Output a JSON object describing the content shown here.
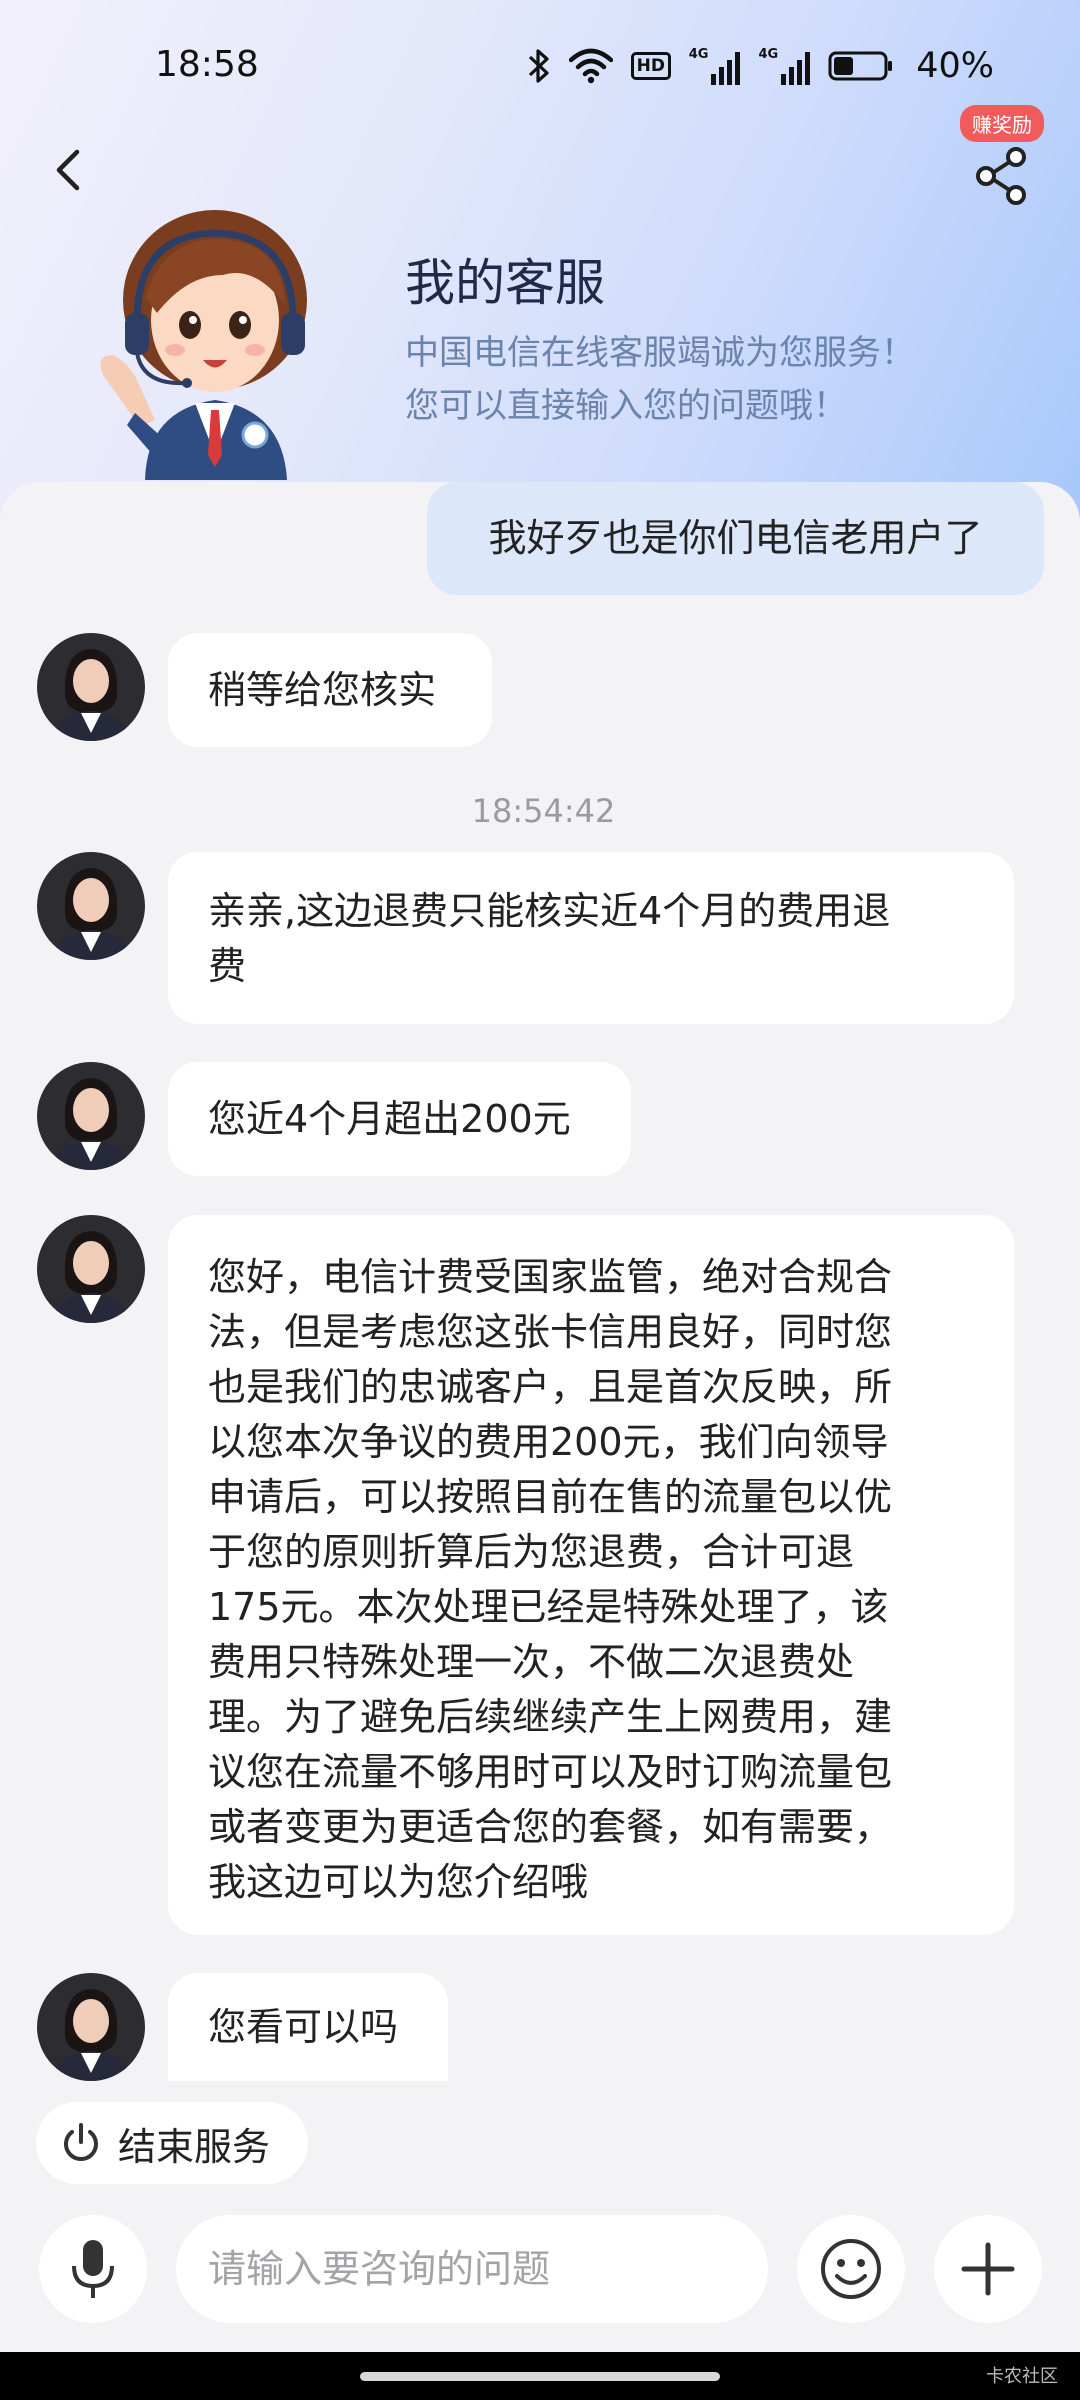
{
  "status_bar": {
    "time": "18:58",
    "hd_label": "HD",
    "net1": "4G",
    "net2": "4G",
    "battery_percent": "40%",
    "battery_level": 0.4
  },
  "header": {
    "reward_badge": "赚奖励",
    "title": "我的客服",
    "subtitle_line1": "中国电信在线客服竭诚为您服务！",
    "subtitle_line2": "您可以直接输入您的问题哦！"
  },
  "chat": {
    "timestamp": "18:54:42",
    "messages": [
      {
        "from": "user",
        "text": "我好歹也是你们电信老用户了"
      },
      {
        "from": "agent",
        "text": "稍等给您核实"
      },
      {
        "from": "agent",
        "lines": [
          "亲亲,这边退费只能核实近4个月的费用退",
          "费"
        ]
      },
      {
        "from": "agent",
        "text": "您近4个月超出200元"
      },
      {
        "from": "agent",
        "lines": [
          "您好，电信计费受国家监管，绝对合规合",
          "法，但是考虑您这张卡信用良好，同时您",
          "也是我们的忠诚客户，且是首次反映，所",
          "以您本次争议的费用200元，我们向领导",
          "申请后，可以按照目前在售的流量包以优",
          "于您的原则折算后为您退费，合计可退",
          "175元。本次处理已经是特殊处理了，该",
          "费用只特殊处理一次，不做二次退费处",
          "理。为了避免后续继续产生上网费用，建",
          "议您在流量不够用时可以及时订购流量包",
          "或者变更为更适合您的套餐，如有需要，",
          "我这边可以为您介绍哦"
        ]
      },
      {
        "from": "agent",
        "text": "您看可以吗"
      }
    ]
  },
  "actions": {
    "end_service_label": "结束服务"
  },
  "input": {
    "placeholder": "请输入要咨询的问题"
  },
  "watermark": "卡农社区",
  "colors": {
    "user_bubble": "#dce7fa",
    "agent_bubble": "#ffffff",
    "chat_background": "#f3f3f6",
    "badge_red": "#f25b5b",
    "subtitle_blue": "#6b84ad"
  }
}
